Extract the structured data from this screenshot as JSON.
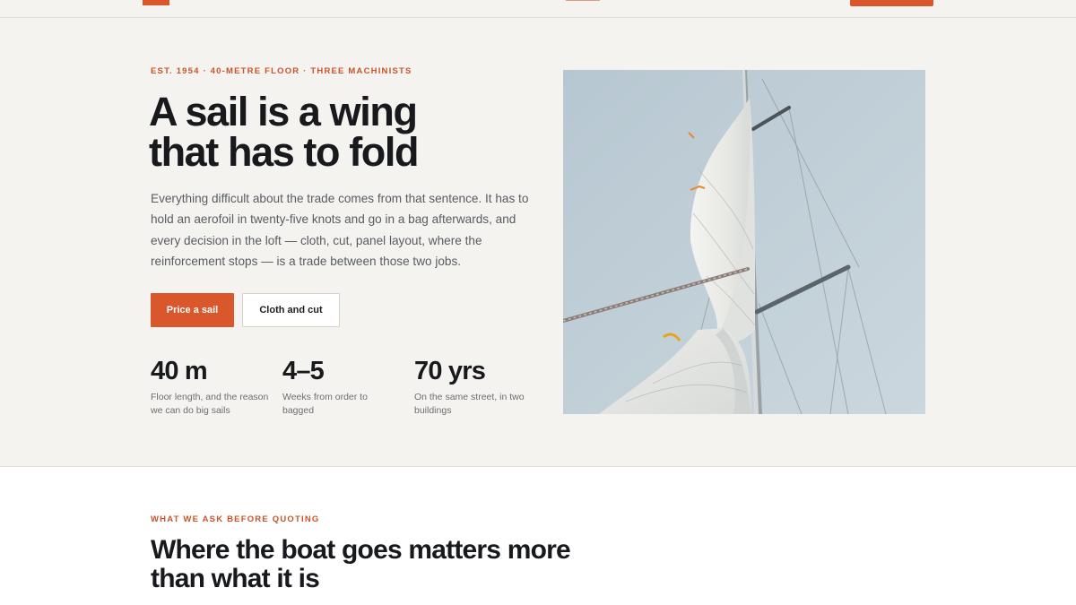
{
  "hero": {
    "eyebrow": "EST. 1954 · 40-METRE FLOOR · THREE MACHINISTS",
    "title_line1": "A sail is a wing",
    "title_line2": "that has to fold",
    "lede": "Everything difficult about the trade comes from that sentence. It has to hold an aerofoil in twenty-five knots and go in a bag afterwards, and every decision in the loft — cloth, cut, panel layout, where the reinforcement stops — is a trade between those two jobs.",
    "primary_button": "Price a sail",
    "secondary_button": "Cloth and cut",
    "stats": [
      {
        "value": "40 m",
        "label": "Floor length, and the reason we can do big sails"
      },
      {
        "value": "4–5",
        "label": "Weeks from order to bagged"
      },
      {
        "value": "70 yrs",
        "label": "On the same street, in two buildings"
      }
    ],
    "photo_icon": "sail-mast-photo"
  },
  "section2": {
    "eyebrow": "WHAT WE ASK BEFORE QUOTING",
    "title_line1": "Where the boat goes matters more",
    "title_line2": "than what it is"
  },
  "colors": {
    "accent": "#d9572b",
    "hero_bg": "#f5f3ef",
    "text": "#17191c",
    "muted": "#585c61"
  }
}
